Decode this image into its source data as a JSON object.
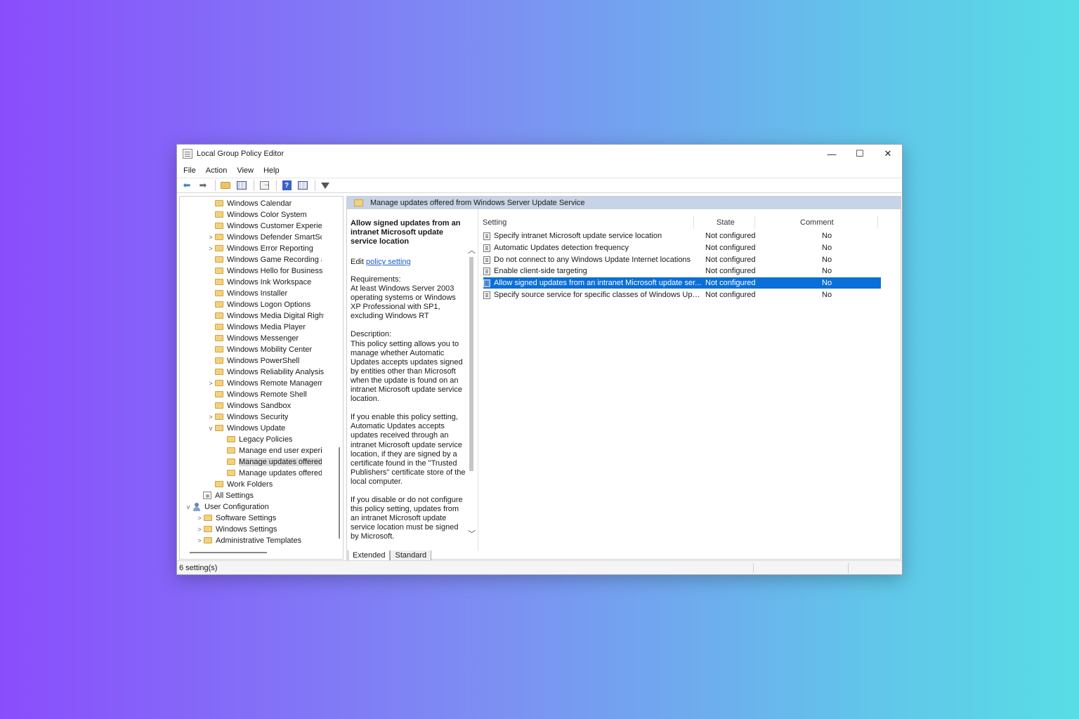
{
  "window": {
    "title": "Local Group Policy Editor",
    "minimize": "—",
    "maximize": "☐",
    "close": "✕"
  },
  "menu": [
    "File",
    "Action",
    "View",
    "Help"
  ],
  "tree": {
    "items": [
      {
        "label": "Windows Calendar",
        "expander": ""
      },
      {
        "label": "Windows Color System",
        "expander": ""
      },
      {
        "label": "Windows Customer Experien",
        "expander": ""
      },
      {
        "label": "Windows Defender SmartScr",
        "expander": ">"
      },
      {
        "label": "Windows Error Reporting",
        "expander": ">"
      },
      {
        "label": "Windows Game Recording ar",
        "expander": ""
      },
      {
        "label": "Windows Hello for Business",
        "expander": ""
      },
      {
        "label": "Windows Ink Workspace",
        "expander": ""
      },
      {
        "label": "Windows Installer",
        "expander": ""
      },
      {
        "label": "Windows Logon Options",
        "expander": ""
      },
      {
        "label": "Windows Media Digital Right",
        "expander": ""
      },
      {
        "label": "Windows Media Player",
        "expander": ""
      },
      {
        "label": "Windows Messenger",
        "expander": ""
      },
      {
        "label": "Windows Mobility Center",
        "expander": ""
      },
      {
        "label": "Windows PowerShell",
        "expander": ""
      },
      {
        "label": "Windows Reliability Analysis",
        "expander": ""
      },
      {
        "label": "Windows Remote Managem",
        "expander": ">"
      },
      {
        "label": "Windows Remote Shell",
        "expander": ""
      },
      {
        "label": "Windows Sandbox",
        "expander": ""
      },
      {
        "label": "Windows Security",
        "expander": ">"
      },
      {
        "label": "Windows Update",
        "expander": "v"
      },
      {
        "label": "Legacy Policies",
        "expander": ""
      },
      {
        "label": "Manage end user experie",
        "expander": ""
      },
      {
        "label": "Manage updates offered",
        "expander": ""
      },
      {
        "label": "Manage updates offered",
        "expander": ""
      },
      {
        "label": "Work Folders",
        "expander": ""
      },
      {
        "label": "All Settings",
        "expander": ""
      },
      {
        "label": "User Configuration",
        "expander": "v"
      },
      {
        "label": "Software Settings",
        "expander": ">"
      },
      {
        "label": "Windows Settings",
        "expander": ">"
      },
      {
        "label": "Administrative Templates",
        "expander": ">"
      }
    ]
  },
  "header_band": {
    "title": "Manage updates offered from Windows Server Update Service"
  },
  "description": {
    "title": "Allow signed updates from an intranet Microsoft update service location",
    "edit_prefix": "Edit",
    "edit_link": "policy setting",
    "requirements": "Requirements:\nAt least Windows Server 2003 operating systems or Windows XP Professional with SP1, excluding Windows RT",
    "description": "Description:\nThis policy setting allows you to manage whether Automatic Updates accepts updates signed by entities other than Microsoft when the update is found on an intranet Microsoft update service location.",
    "enable": "If you enable this policy setting, Automatic Updates accepts updates received through an intranet Microsoft update service location, if they are signed by a certificate found in the \"Trusted Publishers\" certificate store of the local computer.",
    "disable": "If you disable or do not configure this policy setting, updates from an intranet Microsoft update service location must be signed by Microsoft."
  },
  "columns": {
    "setting": "Setting",
    "state": "State",
    "comment": "Comment"
  },
  "settings": [
    {
      "setting": "Specify intranet Microsoft update service location",
      "state": "Not configured",
      "comment": "No"
    },
    {
      "setting": "Automatic Updates detection frequency",
      "state": "Not configured",
      "comment": "No"
    },
    {
      "setting": "Do not connect to any Windows Update Internet locations",
      "state": "Not configured",
      "comment": "No"
    },
    {
      "setting": "Enable client-side targeting",
      "state": "Not configured",
      "comment": "No"
    },
    {
      "setting": "Allow signed updates from an intranet Microsoft update ser...",
      "state": "Not configured",
      "comment": "No"
    },
    {
      "setting": "Specify source service for specific classes of Windows Updat...",
      "state": "Not configured",
      "comment": "No"
    }
  ],
  "tabs": [
    "Extended",
    "Standard"
  ],
  "status": {
    "text": "6 setting(s)"
  },
  "colors": {
    "selection": "#0a6fd8",
    "header_band": "#c7d3e6",
    "link": "#1a5fc7"
  }
}
